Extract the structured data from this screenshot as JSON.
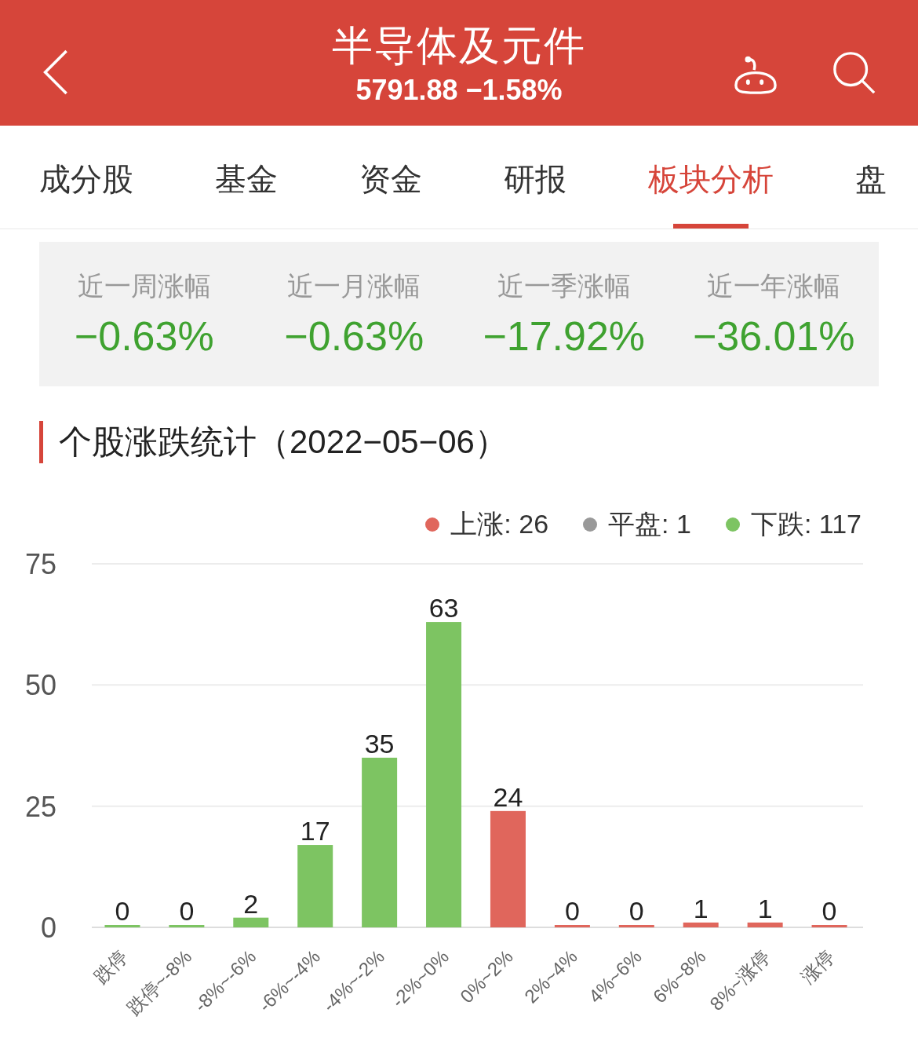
{
  "header": {
    "title": "半导体及元件",
    "quote": "5791.88 −1.58%"
  },
  "tabs": [
    {
      "label": "成分股",
      "selected": false
    },
    {
      "label": "基金",
      "selected": false
    },
    {
      "label": "资金",
      "selected": false
    },
    {
      "label": "研报",
      "selected": false
    },
    {
      "label": "板块分析",
      "selected": true
    },
    {
      "label": "盘",
      "selected": false
    }
  ],
  "returns": [
    {
      "label": "近一周涨幅",
      "value": "−0.63%"
    },
    {
      "label": "近一月涨幅",
      "value": "−0.63%"
    },
    {
      "label": "近一季涨幅",
      "value": "−17.92%"
    },
    {
      "label": "近一年涨幅",
      "value": "−36.01%"
    }
  ],
  "section_title": "个股涨跌统计（2022−05−06）",
  "legend": [
    {
      "label": "上涨: 26",
      "color": "#e0665c"
    },
    {
      "label": "平盘: 1",
      "color": "#999999"
    },
    {
      "label": "下跌: 117",
      "color": "#7dc462"
    }
  ],
  "chart_data": {
    "type": "bar",
    "categories": [
      "跌停",
      "跌停~-8%",
      "-8%~-6%",
      "-6%~-4%",
      "-4%~-2%",
      "-2%~0%",
      "0%~2%",
      "2%~4%",
      "4%~6%",
      "6%~8%",
      "8%~涨停",
      "涨停"
    ],
    "series": [
      {
        "color": "#7dc462",
        "values": [
          0,
          0,
          2,
          17,
          35,
          63,
          null,
          null,
          null,
          null,
          null,
          null
        ]
      },
      {
        "color": "#e0665c",
        "values": [
          null,
          null,
          null,
          null,
          null,
          null,
          24,
          0,
          0,
          1,
          1,
          0
        ]
      }
    ],
    "ylim": [
      0,
      75
    ],
    "yticks": [
      0,
      25,
      50,
      75
    ],
    "data_labels": true
  }
}
